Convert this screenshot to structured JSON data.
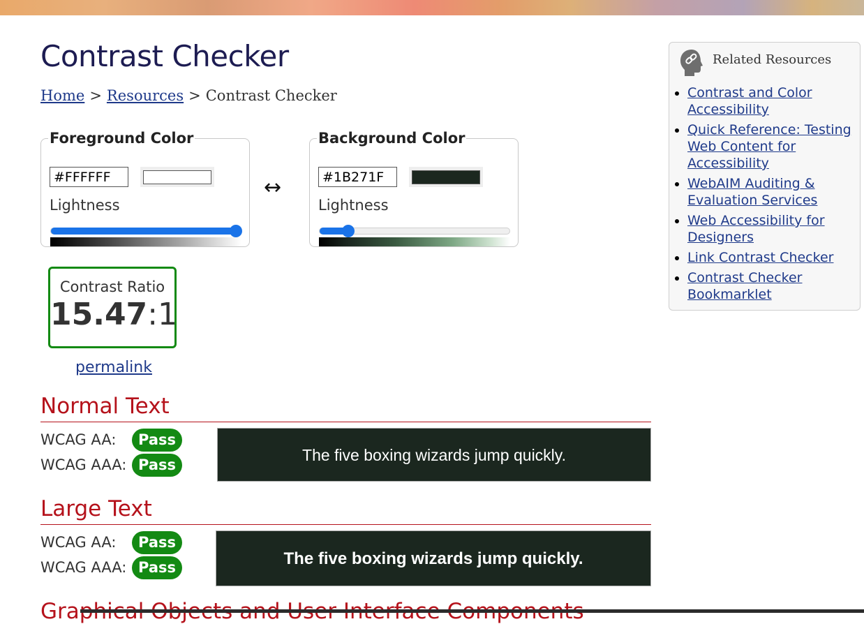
{
  "page": {
    "title": "Contrast Checker"
  },
  "breadcrumb": {
    "home": "Home",
    "resources": "Resources",
    "current": "Contrast Checker",
    "separator": ">"
  },
  "foreground": {
    "legend": "Foreground Color",
    "hex": "#FFFFFF",
    "swatch_color": "#FFFFFF",
    "lightness_label": "Lightness",
    "lightness_percent": 100
  },
  "background": {
    "legend": "Background Color",
    "hex": "#1B271F",
    "swatch_color": "#1B271F",
    "lightness_label": "Lightness",
    "lightness_percent": 15
  },
  "swap_icon": "↔",
  "contrast": {
    "label": "Contrast Ratio",
    "value": "15.47",
    "suffix": ":1",
    "permalink": "permalink"
  },
  "normal_text": {
    "heading": "Normal Text",
    "aa_label": "WCAG AA:",
    "aa_result": "Pass",
    "aaa_label": "WCAG AAA:",
    "aaa_result": "Pass",
    "sample": "The five boxing wizards jump quickly."
  },
  "large_text": {
    "heading": "Large Text",
    "aa_label": "WCAG AA:",
    "aa_result": "Pass",
    "aaa_label": "WCAG AAA:",
    "aaa_result": "Pass",
    "sample": "The five boxing wizards jump quickly."
  },
  "graphical_heading": "Graphical Objects and User Interface Components",
  "sidebar": {
    "title": "Related Resources",
    "icon": "link-head-icon",
    "items": [
      {
        "label": "Contrast and Color Accessibility"
      },
      {
        "label": "Quick Reference: Testing Web Content for Accessibility"
      },
      {
        "label": "WebAIM Auditing & Evaluation Services"
      },
      {
        "label": "Web Accessibility for Designers"
      },
      {
        "label": "Link Contrast Checker"
      },
      {
        "label": "Contrast Checker Bookmarklet"
      }
    ]
  },
  "colors": {
    "pass": "#138A13",
    "heading_red": "#B5121B",
    "title_navy": "#1D1C52",
    "link": "#1F3A8A",
    "slider_blue": "#1A73E8"
  }
}
